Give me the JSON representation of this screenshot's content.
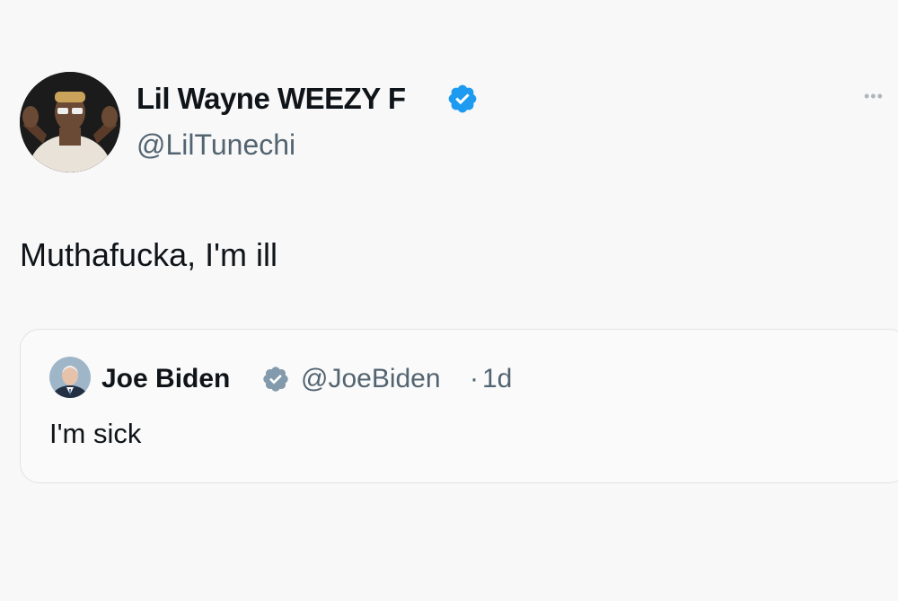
{
  "tweet": {
    "author": {
      "display_name": "Lil Wayne WEEZY F",
      "handle": "@LilTunechi",
      "verified": true,
      "avatar": "user-avatar-photo"
    },
    "more_label": "•••",
    "text": "Muthafucka, I'm ill"
  },
  "quoted_tweet": {
    "author": {
      "display_name": "Joe Biden",
      "handle": "@JoeBiden",
      "verified": true,
      "badge_color": "gray",
      "avatar": "user-avatar-photo"
    },
    "separator": "·",
    "time": "1d",
    "text": "I'm sick"
  },
  "colors": {
    "verified_blue": "#1d9bf0",
    "verified_gray": "#829aab",
    "secondary_text": "#536471",
    "border": "#dfe3e6"
  }
}
